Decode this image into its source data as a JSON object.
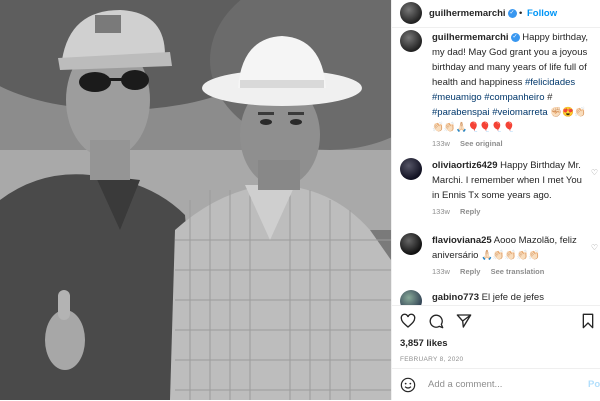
{
  "header": {
    "username": "guilhermemarchi",
    "separator": "•",
    "follow_label": "Follow"
  },
  "caption": {
    "username": "guilhermemarchi",
    "text": "Happy birthday, my dad! May God grant you a joyous birthday and many years of life full of health and happiness",
    "hashtags": [
      "#felicidades",
      "#meuamigo",
      "#companheiro",
      "#parabenspai",
      "#veiomarreta"
    ],
    "emoji_line": "👏🏻👏🏻🙏🏻🎈🎈🎈🎈",
    "trailing_emoji": "✊🏻😍👏🏻",
    "time": "133w",
    "see_original": "See original"
  },
  "comments": [
    {
      "username": "oliviaortiz6429",
      "text": "Happy Birthday Mr. Marchi. I remember when I met You in Ennis Tx some years ago.",
      "time": "133w",
      "reply": "Reply"
    },
    {
      "username": "flavioviana25",
      "text": "Aooo Mazolão, feliz aniversário 🙏🏻👏🏻👏🏻👏🏻👏🏻",
      "time": "133w",
      "reply": "Reply",
      "see_translation": "See translation"
    },
    {
      "username": "gabino773",
      "text": "El jefe de jefes"
    }
  ],
  "footer": {
    "likes": "3,857 likes",
    "date": "FEBRUARY 8, 2020",
    "comment_placeholder": "Add a comment...",
    "post_label": "Post"
  },
  "colors": {
    "accent": "#0095f6",
    "link": "#00376b",
    "muted": "#8e8e8e",
    "verified": "#3897f0"
  }
}
